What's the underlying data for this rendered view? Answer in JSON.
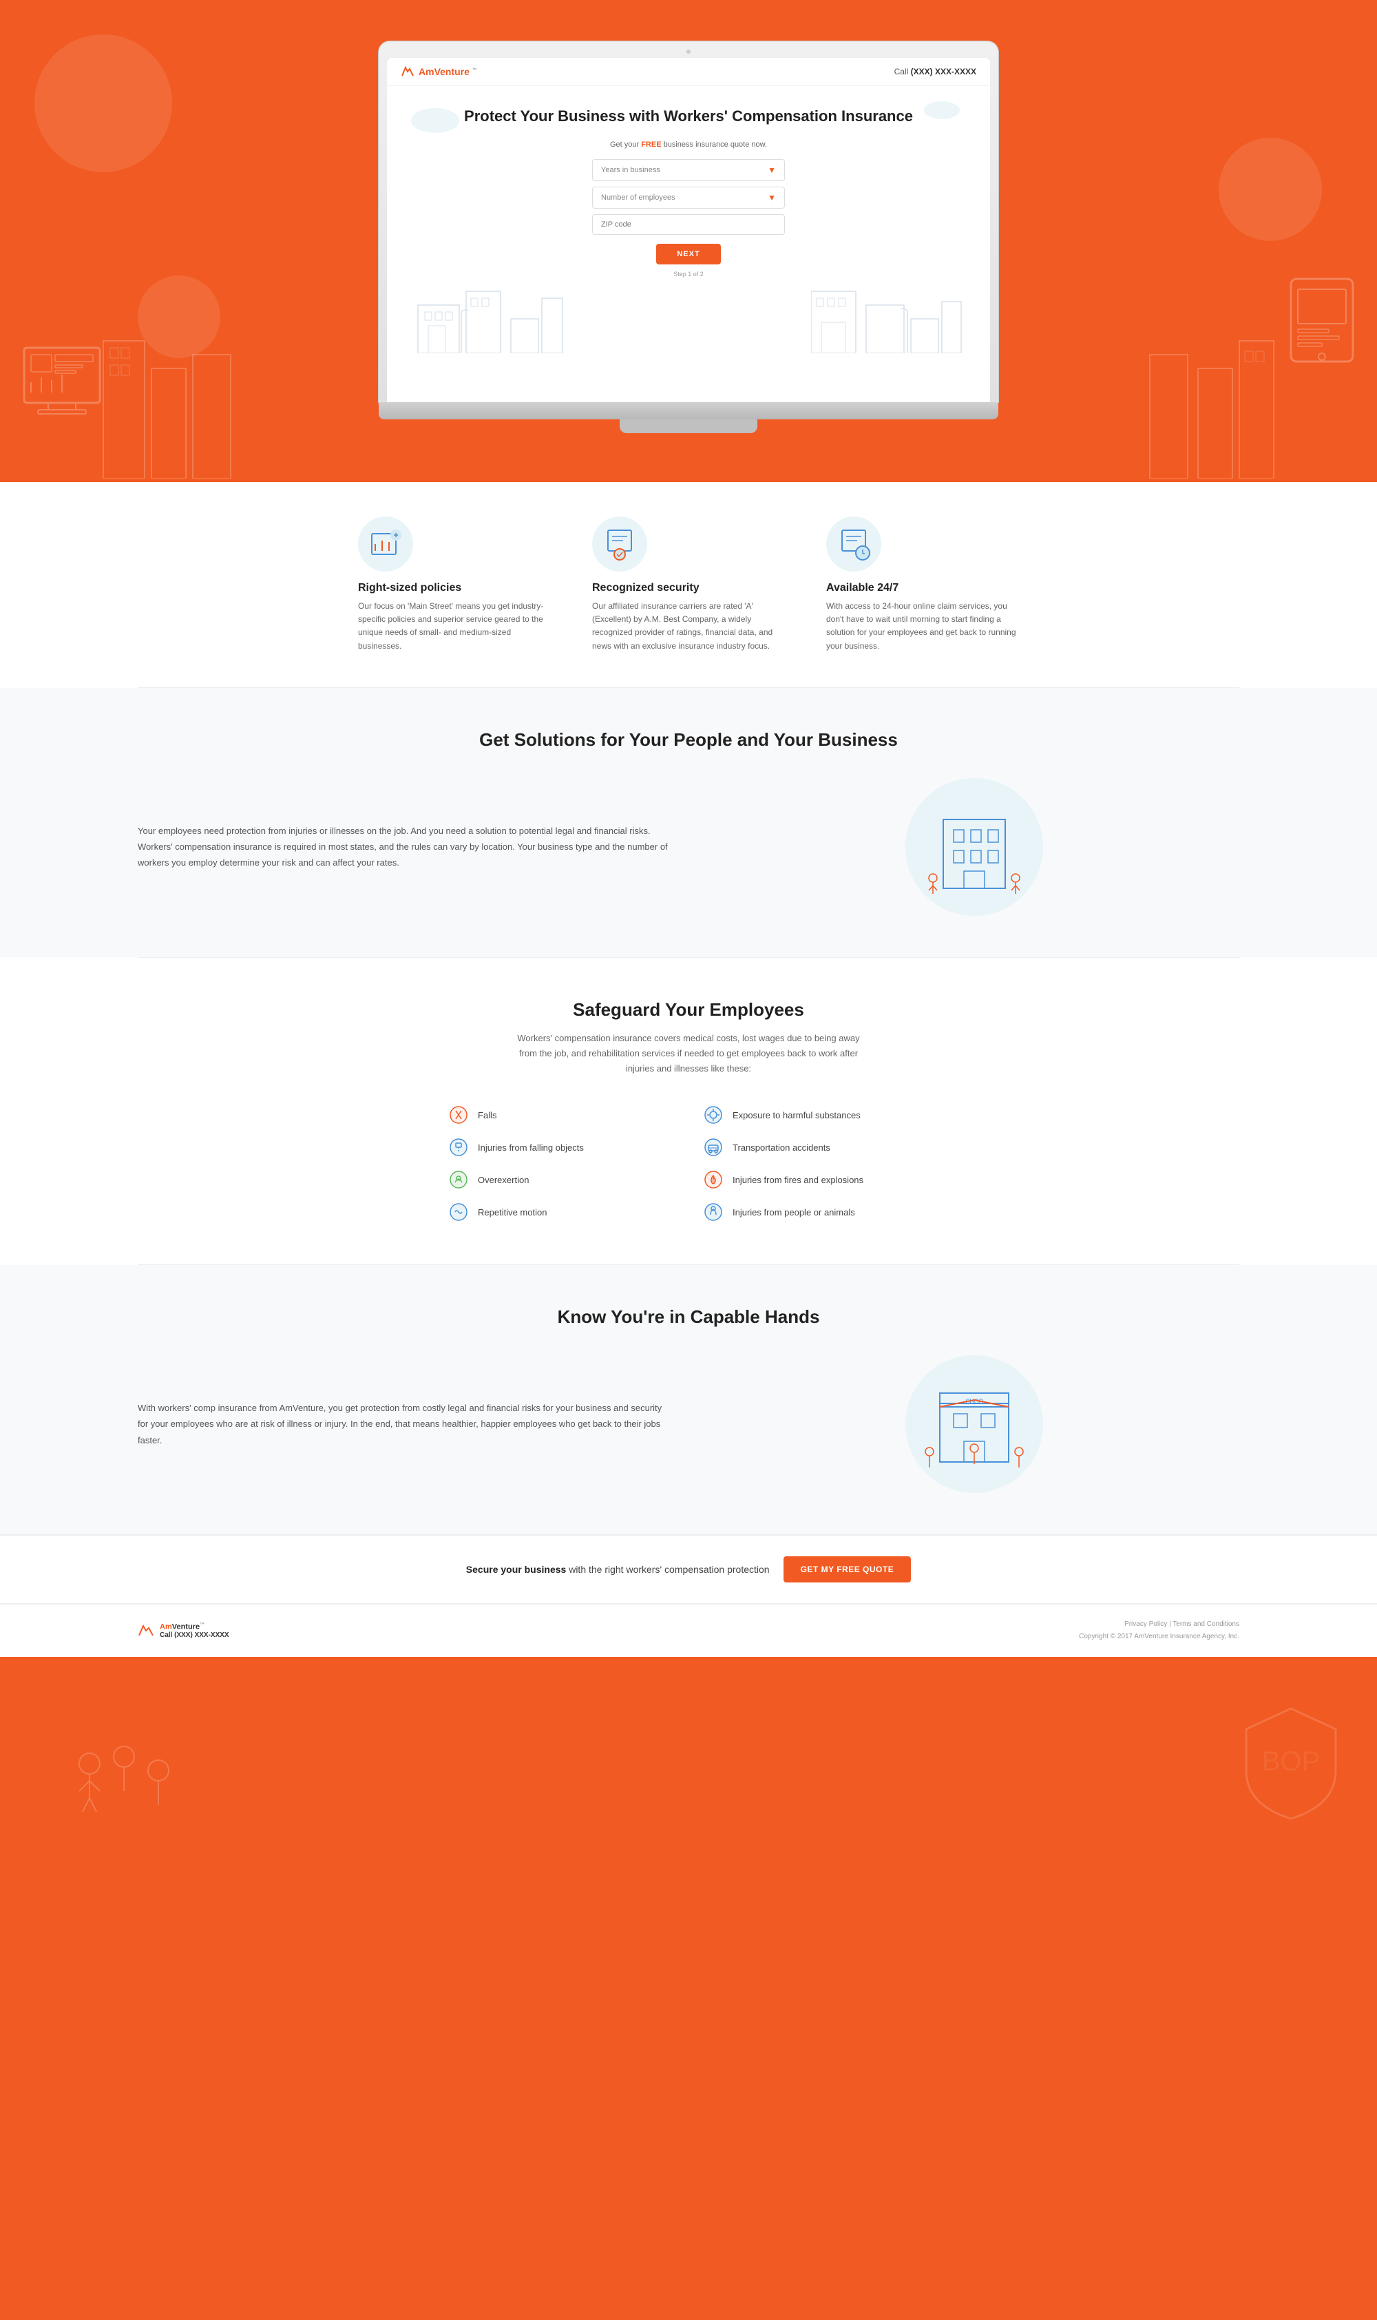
{
  "site": {
    "logo_text": "AmVenture",
    "logo_accent": "Am",
    "phone": "Call (XXX) XXX-XXXX"
  },
  "header": {
    "call_label": "Call",
    "phone_number": "(XXX) XXX-XXXX"
  },
  "hero": {
    "title": "Protect Your Business with Workers' Compensation Insurance",
    "subtitle_pre": "Get your ",
    "subtitle_free": "FREE",
    "subtitle_post": " business insurance quote now.",
    "form": {
      "years_business": "Years in business",
      "num_employees": "Number of employees",
      "zip_placeholder": "ZIP code",
      "button_label": "NEXT",
      "step_text": "Step 1 of 2"
    }
  },
  "features": [
    {
      "id": "right-sized",
      "title": "Right-sized policies",
      "description": "Our focus on 'Main Street' means you get industry-specific policies and superior service geared to the unique needs of small- and medium-sized businesses."
    },
    {
      "id": "recognized",
      "title": "Recognized security",
      "description": "Our affiliated insurance carriers are rated 'A' (Excellent) by A.M. Best Company, a widely recognized provider of ratings, financial data, and news with an exclusive insurance industry focus."
    },
    {
      "id": "available",
      "title": "Available 24/7",
      "description": "With access to 24-hour online claim services, you don't have to wait until morning to start finding a solution for your employees and get back to running your business."
    }
  ],
  "solutions": {
    "title": "Get Solutions for Your People and Your Business",
    "body": "Your employees need protection from injuries or illnesses on the job. And you need a solution to potential legal and financial risks. Workers' compensation insurance is required in most states, and the rules can vary by location. Your business type and the number of workers you employ determine your risk and can affect your rates."
  },
  "safeguard": {
    "title": "Safeguard Your Employees",
    "subtitle": "Workers' compensation insurance covers medical costs, lost wages due to being away from the job, and rehabilitation services if needed to get employees back to work after injuries and illnesses like these:",
    "items": [
      {
        "id": "falls",
        "label": "Falls",
        "col": "left"
      },
      {
        "id": "exposure",
        "label": "Exposure to harmful substances",
        "col": "right"
      },
      {
        "id": "falling-objects",
        "label": "Injuries from falling objects",
        "col": "left"
      },
      {
        "id": "transportation",
        "label": "Transportation accidents",
        "col": "right"
      },
      {
        "id": "overexertion",
        "label": "Overexertion",
        "col": "left"
      },
      {
        "id": "fires",
        "label": "Injuries from fires and explosions",
        "col": "right"
      },
      {
        "id": "repetitive",
        "label": "Repetitive motion",
        "col": "left"
      },
      {
        "id": "animals",
        "label": "Injuries from people or animals",
        "col": "right"
      }
    ]
  },
  "capable": {
    "title": "Know You're in Capable Hands",
    "body": "With workers' comp insurance from AmVenture, you get protection from costly legal and financial risks for your business and security for your employees who are at risk of illness or injury. In the end, that means healthier, happier employees who get back to their jobs faster."
  },
  "cta": {
    "text_pre": "Secure your business",
    "text_post": " with the right workers' compensation protection",
    "button_label": "GET MY FREE QUOTE"
  },
  "footer": {
    "phone_label": "Call (XXX) XXX-XXXX",
    "links": {
      "privacy": "Privacy Policy",
      "terms": "Terms and Conditions"
    },
    "copyright": "Copyright © 2017 AmVenture Insurance Agency, Inc."
  }
}
